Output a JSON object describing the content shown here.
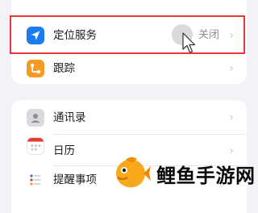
{
  "top_group": {
    "location": {
      "label": "定位服务",
      "value": "关闭",
      "icon": "location-arrow-icon",
      "color": "#1b7cf2"
    },
    "tracking": {
      "label": "跟踪",
      "icon": "tracking-icon",
      "color": "#f59a23"
    }
  },
  "bottom_group": {
    "items": [
      {
        "label": "通讯录",
        "icon": "contacts-icon"
      },
      {
        "label": "日历",
        "icon": "calendar-icon"
      },
      {
        "label": "提醒事项",
        "icon": "reminders-icon"
      }
    ]
  },
  "chevron": "›",
  "watermark": {
    "text": "鲤鱼手游网"
  },
  "colors": {
    "highlight": "#e8383d",
    "background": "#f2f2f7"
  }
}
